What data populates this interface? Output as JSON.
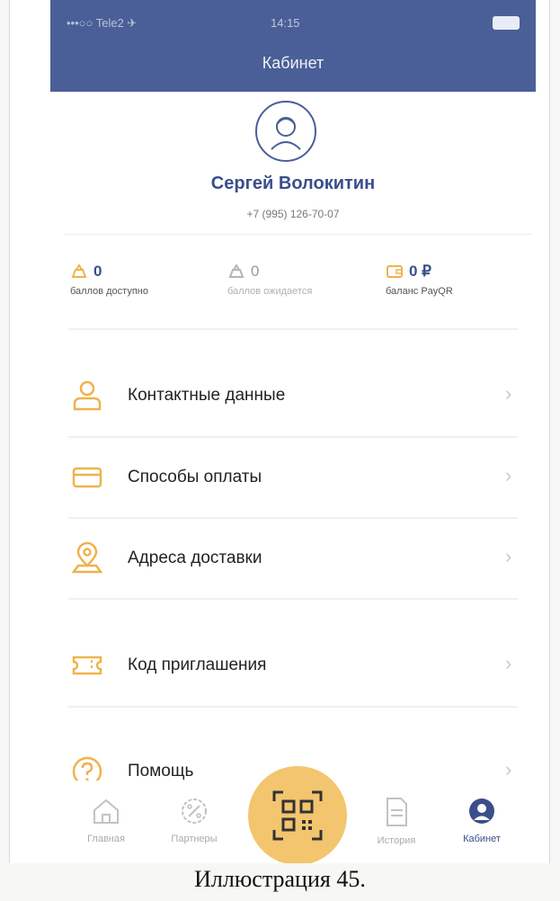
{
  "status": {
    "carrier": "•••○○ Tele2 ✈",
    "time": "14:15"
  },
  "header": {
    "title": "Кабинет"
  },
  "profile": {
    "name": "Сергей Волокитин",
    "phone": "+7 (995) 126-70-07"
  },
  "stats": [
    {
      "icon": "coin-stack-icon",
      "value": "0",
      "caption": "баллов доступно",
      "color": "#3a4e8c"
    },
    {
      "icon": "coin-stack-outline-icon",
      "value": "0",
      "caption": "баллов ожидается",
      "color": "#9a9a9a"
    },
    {
      "icon": "wallet-icon",
      "value": "0 ₽",
      "caption": "баланс PayQR",
      "color": "#3a4e8c"
    }
  ],
  "menu": [
    {
      "icon": "person-icon",
      "label": "Контактные данные"
    },
    {
      "icon": "card-icon",
      "label": "Способы оплаты"
    },
    {
      "icon": "location-pin-icon",
      "label": "Адреса доставки"
    },
    {
      "icon": "ticket-icon",
      "label": "Код приглашения"
    },
    {
      "icon": "help-icon",
      "label": "Помощь"
    }
  ],
  "tabs": [
    {
      "icon": "home-icon",
      "label": "Главная"
    },
    {
      "icon": "percent-badge-icon",
      "label": "Партнеры"
    },
    {
      "icon": "document-icon",
      "label": "История"
    },
    {
      "icon": "profile-icon",
      "label": "Кабинет",
      "active": true
    }
  ],
  "caption": "Иллюстрация 45.",
  "colors": {
    "nav": "#4a5f97",
    "accent_orange": "#f0b24c",
    "accent_blue": "#3a4e8c",
    "qr_button": "#f3c56e"
  }
}
